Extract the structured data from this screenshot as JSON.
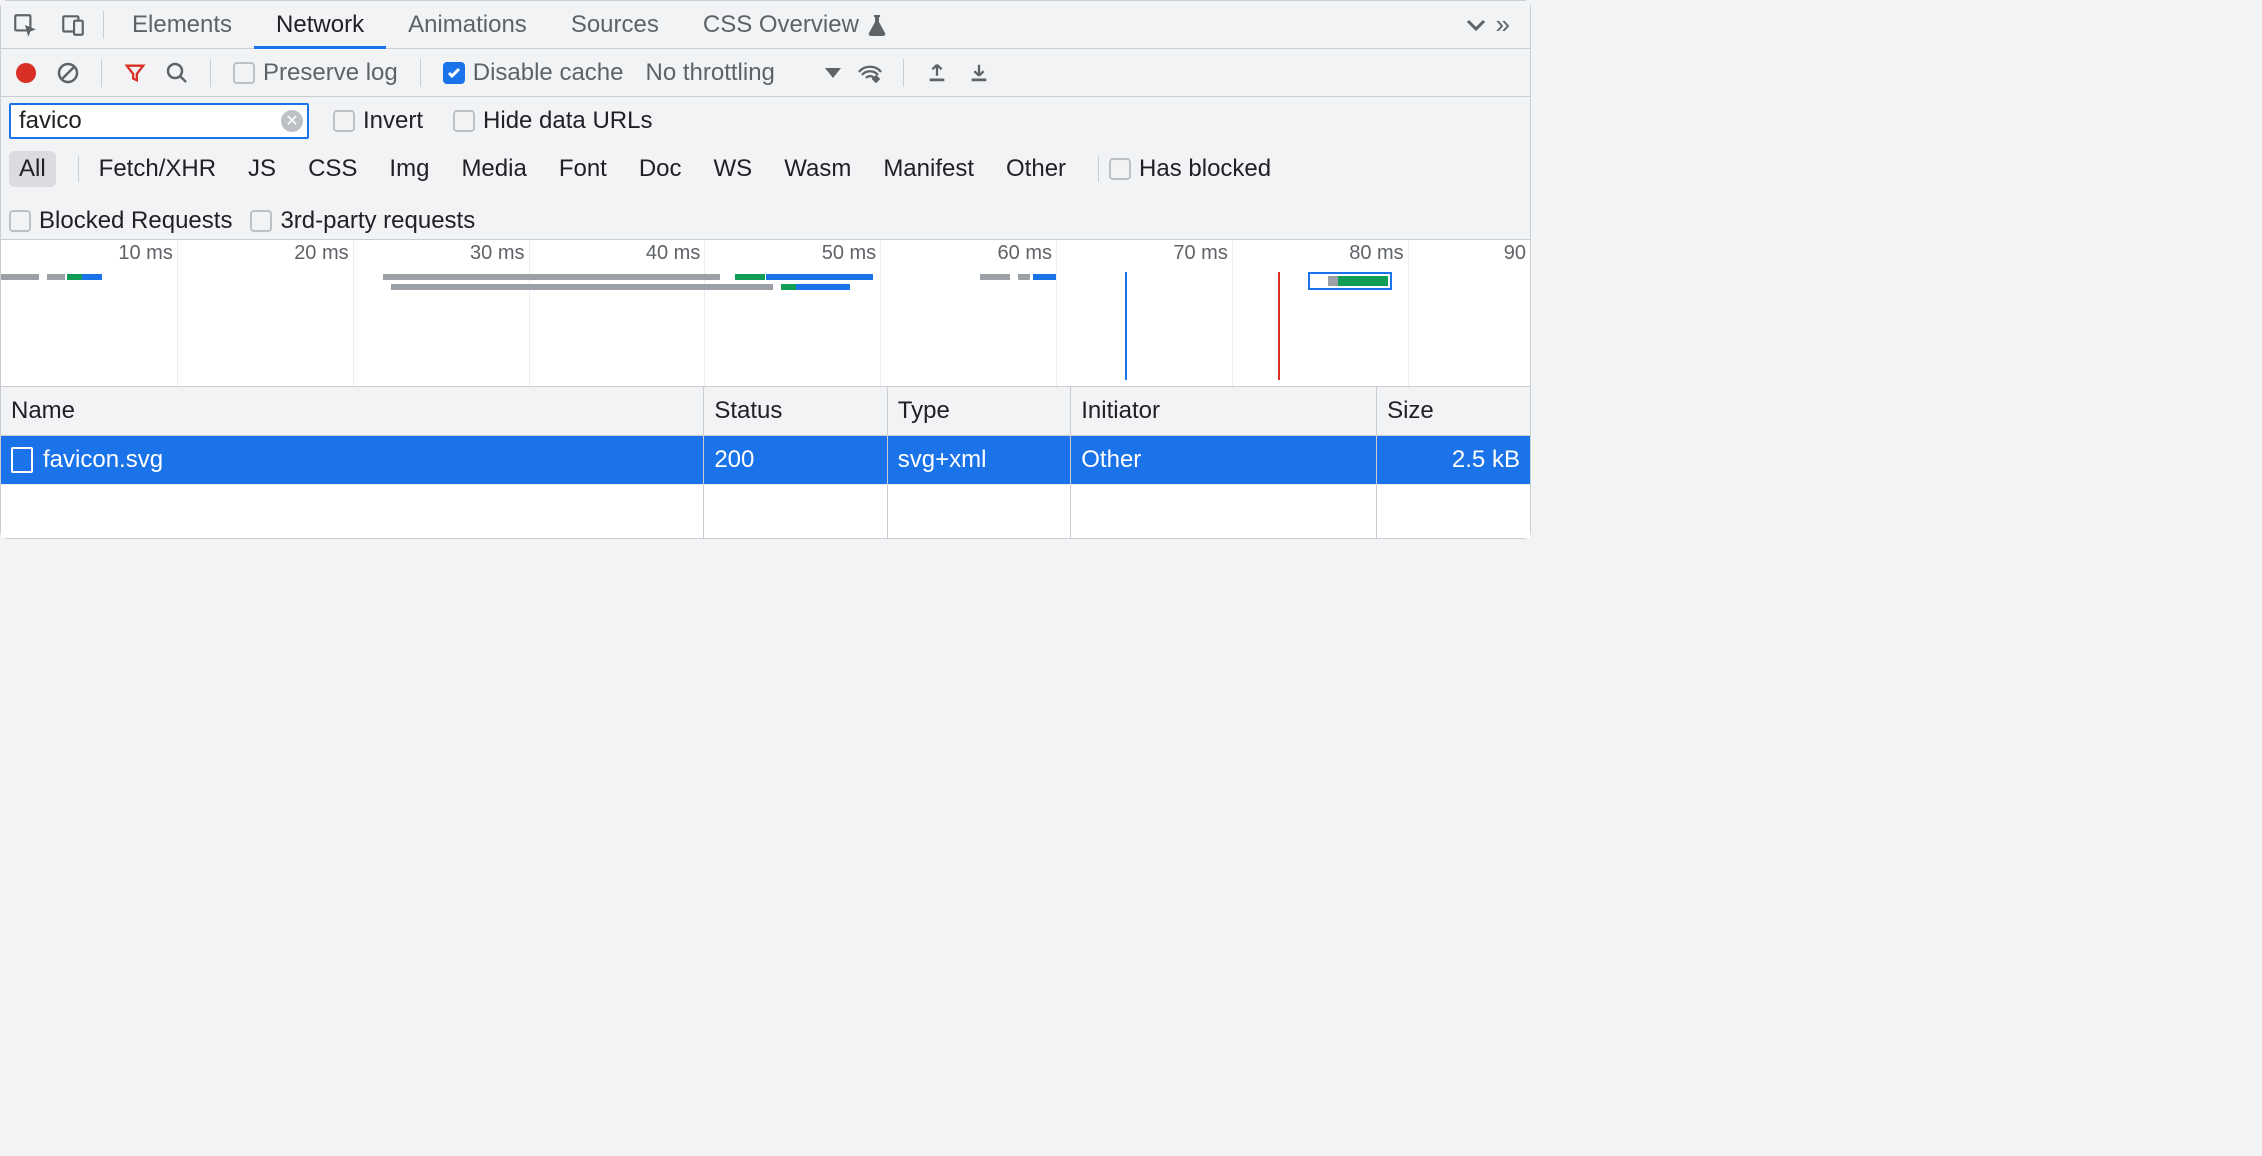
{
  "tabs": {
    "elements": "Elements",
    "network": "Network",
    "animations": "Animations",
    "sources": "Sources",
    "css_overview": "CSS Overview"
  },
  "toolbar": {
    "preserve_log": "Preserve log",
    "disable_cache": "Disable cache",
    "throttling": "No throttling"
  },
  "filter": {
    "value": "favico",
    "invert": "Invert",
    "hide_data_urls": "Hide data URLs"
  },
  "type_chips": [
    "All",
    "Fetch/XHR",
    "JS",
    "CSS",
    "Img",
    "Media",
    "Font",
    "Doc",
    "WS",
    "Wasm",
    "Manifest",
    "Other"
  ],
  "type_extras": {
    "has_blocked": "Has blocked",
    "blocked_requests": "Blocked Requests",
    "third_party": "3rd-party requests"
  },
  "timeline_ticks": [
    "10 ms",
    "20 ms",
    "30 ms",
    "40 ms",
    "50 ms",
    "60 ms",
    "70 ms",
    "80 ms",
    "90"
  ],
  "columns": {
    "name": "Name",
    "status": "Status",
    "type": "Type",
    "initiator": "Initiator",
    "size": "Size"
  },
  "rows": [
    {
      "name": "favicon.svg",
      "status": "200",
      "type": "svg+xml",
      "initiator": "Other",
      "size": "2.5 kB"
    }
  ]
}
